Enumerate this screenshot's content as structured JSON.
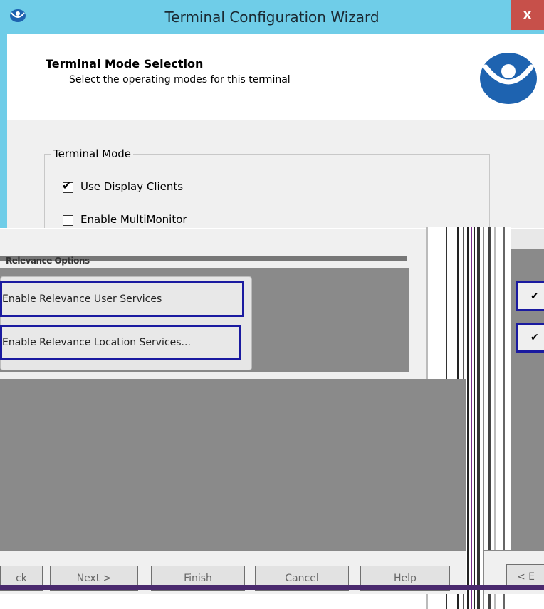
{
  "window": {
    "title": "Terminal Configuration Wizard",
    "close_label": "x"
  },
  "header": {
    "title": "Terminal Mode Selection",
    "subtitle": "Select the operating modes for this terminal"
  },
  "terminal_mode": {
    "group_label": "Terminal Mode",
    "options": [
      {
        "label": "Use Display Clients",
        "checked": true
      },
      {
        "label": "Enable MultiMonitor",
        "checked": false
      }
    ]
  },
  "glitch": {
    "section_label": "Relevance Options",
    "buttons": [
      "Enable Relevance User Services",
      "Enable Relevance Location Services..."
    ],
    "right_checkmarks": [
      "✔",
      "✔"
    ]
  },
  "footer": {
    "back_label": "ck",
    "next_label": "Next >",
    "finish_label": "Finish",
    "cancel_label": "Cancel",
    "help_label": "Help",
    "right_back_label": "< E"
  },
  "colors": {
    "titlebar": "#6fcde8",
    "close_button": "#c7504a",
    "logo_blue": "#1e63b0",
    "glitch_border": "#1a1aa0"
  }
}
